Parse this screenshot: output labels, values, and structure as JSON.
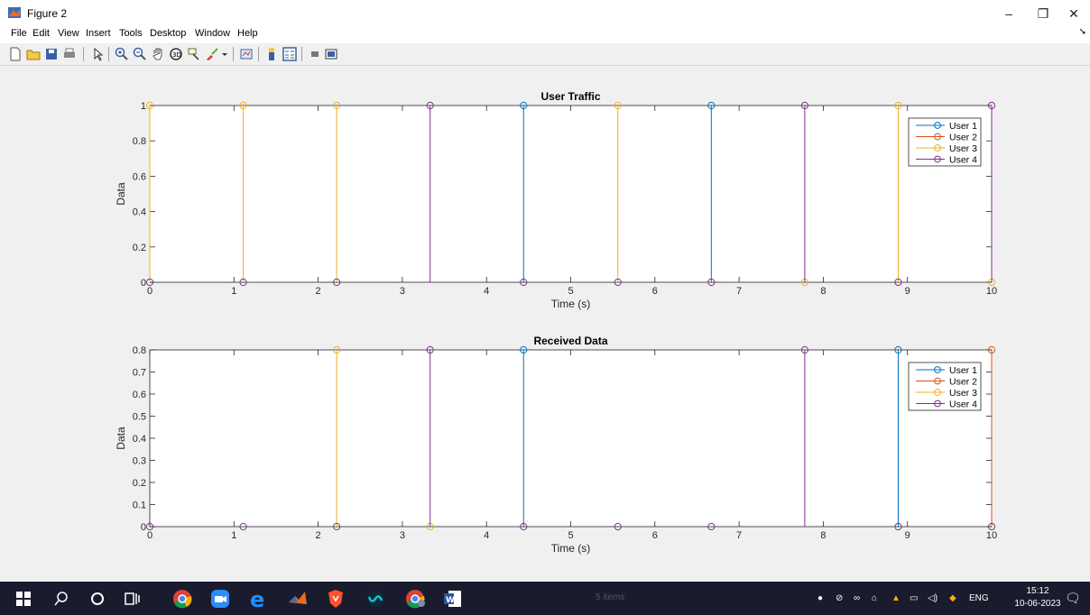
{
  "window": {
    "title": "Figure 2",
    "controls": [
      "–",
      "❐",
      "✕"
    ]
  },
  "menu": [
    "File",
    "Edit",
    "View",
    "Insert",
    "Tools",
    "Desktop",
    "Window",
    "Help"
  ],
  "toolbar_icons": [
    "new-figure-icon",
    "open-file-icon",
    "save-icon",
    "print-icon",
    "pointer-icon",
    "zoom-in-icon",
    "zoom-out-icon",
    "pan-icon",
    "rotate-3d-icon",
    "data-cursor-icon",
    "brush-icon",
    "dropdown-icon",
    "link-plot-icon",
    "colorbar-icon",
    "legend-icon",
    "hide-plot-tools-icon",
    "show-plot-tools-icon"
  ],
  "colors": {
    "user1": "#0072bd",
    "user2": "#d95319",
    "user3": "#edb120",
    "user4": "#7e2f8e"
  },
  "charts": [
    {
      "title": "User Traffic",
      "xlabel": "Time (s)",
      "ylabel": "Data",
      "xlim": [
        0,
        10
      ],
      "ylim": [
        0,
        1
      ],
      "xticks": [
        0,
        1,
        2,
        3,
        4,
        5,
        6,
        7,
        8,
        9,
        10
      ],
      "yticks": [
        0,
        0.2,
        0.4,
        0.6,
        0.8,
        1
      ],
      "ytick_labels": [
        "0",
        "0.2",
        "0.4",
        "0.6",
        "0.8",
        "1"
      ],
      "legend": [
        "User 1",
        "User 2",
        "User 3",
        "User 4"
      ]
    },
    {
      "title": "Received Data",
      "xlabel": "Time (s)",
      "ylabel": "Data",
      "xlim": [
        0,
        10
      ],
      "ylim": [
        0,
        0.8
      ],
      "xticks": [
        0,
        1,
        2,
        3,
        4,
        5,
        6,
        7,
        8,
        9,
        10
      ],
      "yticks": [
        0,
        0.1,
        0.2,
        0.3,
        0.4,
        0.5,
        0.6,
        0.7,
        0.8
      ],
      "ytick_labels": [
        "0",
        "0.1",
        "0.2",
        "0.3",
        "0.4",
        "0.5",
        "0.6",
        "0.7",
        "0.8"
      ],
      "legend": [
        "User 1",
        "User 2",
        "User 3",
        "User 4"
      ]
    }
  ],
  "chart_data": [
    {
      "type": "stem",
      "title": "User Traffic",
      "xlabel": "Time (s)",
      "ylabel": "Data",
      "xlim": [
        0,
        10
      ],
      "ylim": [
        0,
        1
      ],
      "series": [
        {
          "name": "User 1",
          "color": "#0072bd",
          "points": [
            [
              4.44,
              1
            ],
            [
              6.67,
              1
            ]
          ]
        },
        {
          "name": "User 2",
          "color": "#d95319",
          "points": []
        },
        {
          "name": "User 3",
          "color": "#edb120",
          "points": [
            [
              0,
              1
            ],
            [
              1.11,
              1
            ],
            [
              2.22,
              1
            ],
            [
              5.56,
              1
            ],
            [
              7.78,
              0
            ],
            [
              8.89,
              1
            ],
            [
              10,
              0
            ]
          ]
        },
        {
          "name": "User 4",
          "color": "#7e2f8e",
          "points": [
            [
              0,
              0
            ],
            [
              1.11,
              0
            ],
            [
              2.22,
              0
            ],
            [
              3.33,
              1
            ],
            [
              4.44,
              0
            ],
            [
              5.56,
              0
            ],
            [
              6.67,
              0
            ],
            [
              7.78,
              1
            ],
            [
              8.89,
              0
            ],
            [
              10,
              1
            ]
          ]
        }
      ],
      "legend": "top-right"
    },
    {
      "type": "stem",
      "title": "Received Data",
      "xlabel": "Time (s)",
      "ylabel": "Data",
      "xlim": [
        0,
        10
      ],
      "ylim": [
        0,
        0.8
      ],
      "series": [
        {
          "name": "User 1",
          "color": "#0072bd",
          "points": [
            [
              4.44,
              0.8
            ],
            [
              8.89,
              0.8
            ]
          ]
        },
        {
          "name": "User 2",
          "color": "#d95319",
          "points": [
            [
              10,
              0.8
            ]
          ]
        },
        {
          "name": "User 3",
          "color": "#edb120",
          "points": [
            [
              2.22,
              0.8
            ],
            [
              3.33,
              0
            ]
          ]
        },
        {
          "name": "User 4",
          "color": "#7e2f8e",
          "points": [
            [
              0,
              0
            ],
            [
              1.11,
              0
            ],
            [
              2.22,
              0
            ],
            [
              3.33,
              0.8
            ],
            [
              4.44,
              0
            ],
            [
              5.56,
              0
            ],
            [
              6.67,
              0
            ],
            [
              7.78,
              0.8
            ],
            [
              8.89,
              0
            ],
            [
              10,
              0
            ]
          ]
        }
      ],
      "legend": "top-right"
    }
  ],
  "taskbar": {
    "status": "5 items",
    "apps": [
      "start-icon",
      "search-icon",
      "cortana-icon",
      "task-view-icon",
      "chrome-icon",
      "zoom-icon",
      "edge-icon",
      "matlab-icon",
      "brave-icon",
      "webex-icon",
      "chrome-alt-icon",
      "word-icon"
    ],
    "lang": "ENG",
    "time": "15:12",
    "date": "10-06-2023",
    "notif": "1"
  }
}
